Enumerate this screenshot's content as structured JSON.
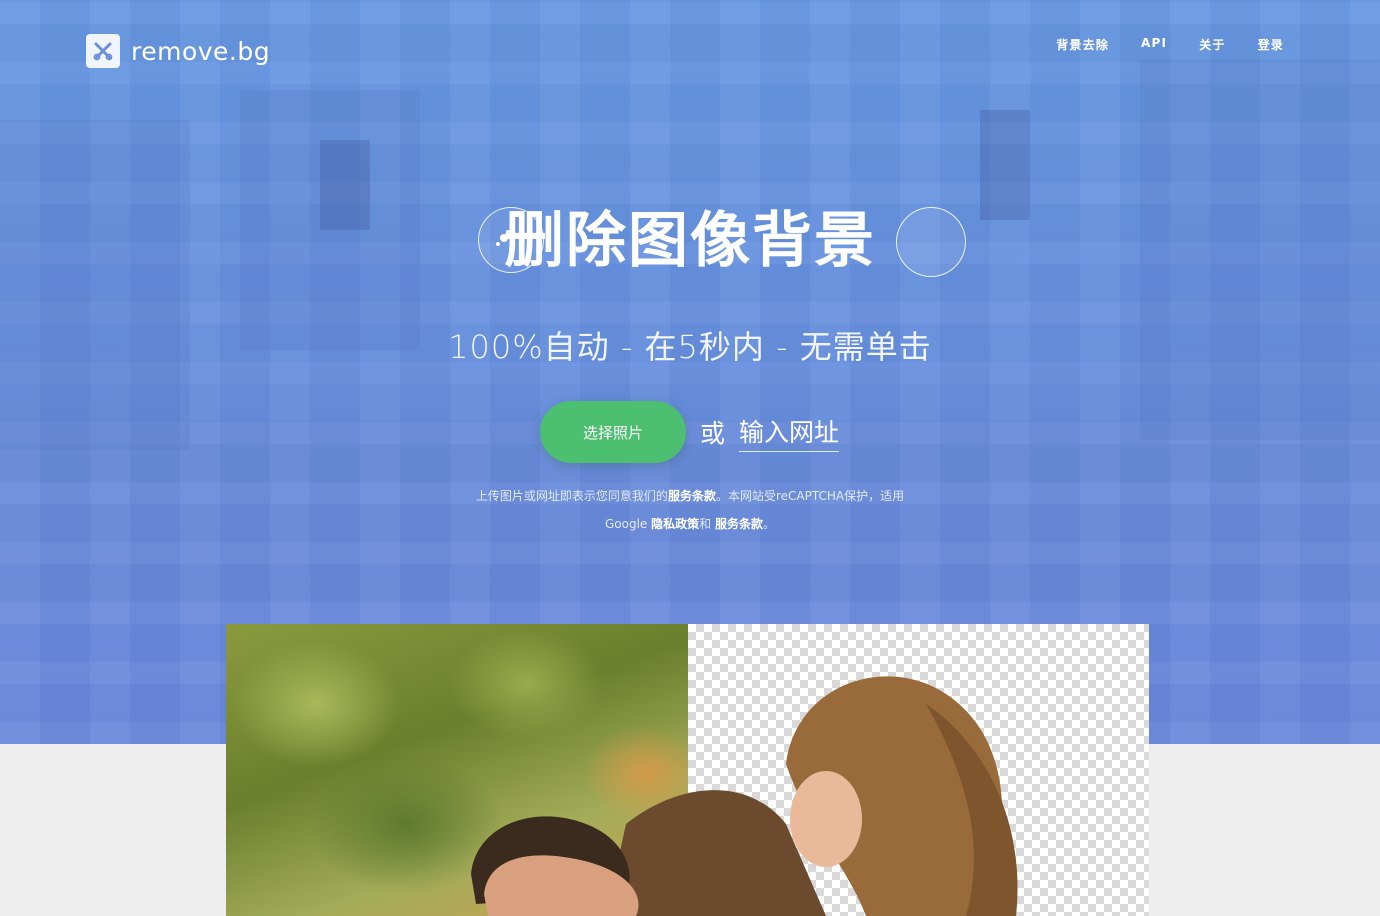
{
  "header": {
    "logo_text": "remove.bg",
    "nav": [
      {
        "label": "背景去除"
      },
      {
        "label": "API"
      },
      {
        "label": "关于"
      },
      {
        "label": "登录"
      }
    ]
  },
  "hero": {
    "title": "删除图像背景",
    "subtitle": "100%自动 - 在5秒内 - 无需单击",
    "upload_button": "选择照片",
    "or_text": "或",
    "url_link": "输入网址",
    "legal_line1_prefix": "上传图片或网址即表示您同意我们的",
    "legal_line1_terms": "服务条款",
    "legal_line1_suffix": "。本网站受reCAPTCHA保护，适用",
    "legal_line2_prefix": "Google ",
    "legal_line2_privacy": "隐私政策",
    "legal_line2_and": "和 ",
    "legal_line2_terms": "服务条款",
    "legal_line2_end": "。"
  },
  "colors": {
    "hero_gradient_top": "#6697e2",
    "hero_gradient_bottom": "#6a86dc",
    "cta_green": "#4cbf70",
    "page_bg": "#efeeee"
  },
  "icons": {
    "logo": "scissors-x-icon"
  }
}
